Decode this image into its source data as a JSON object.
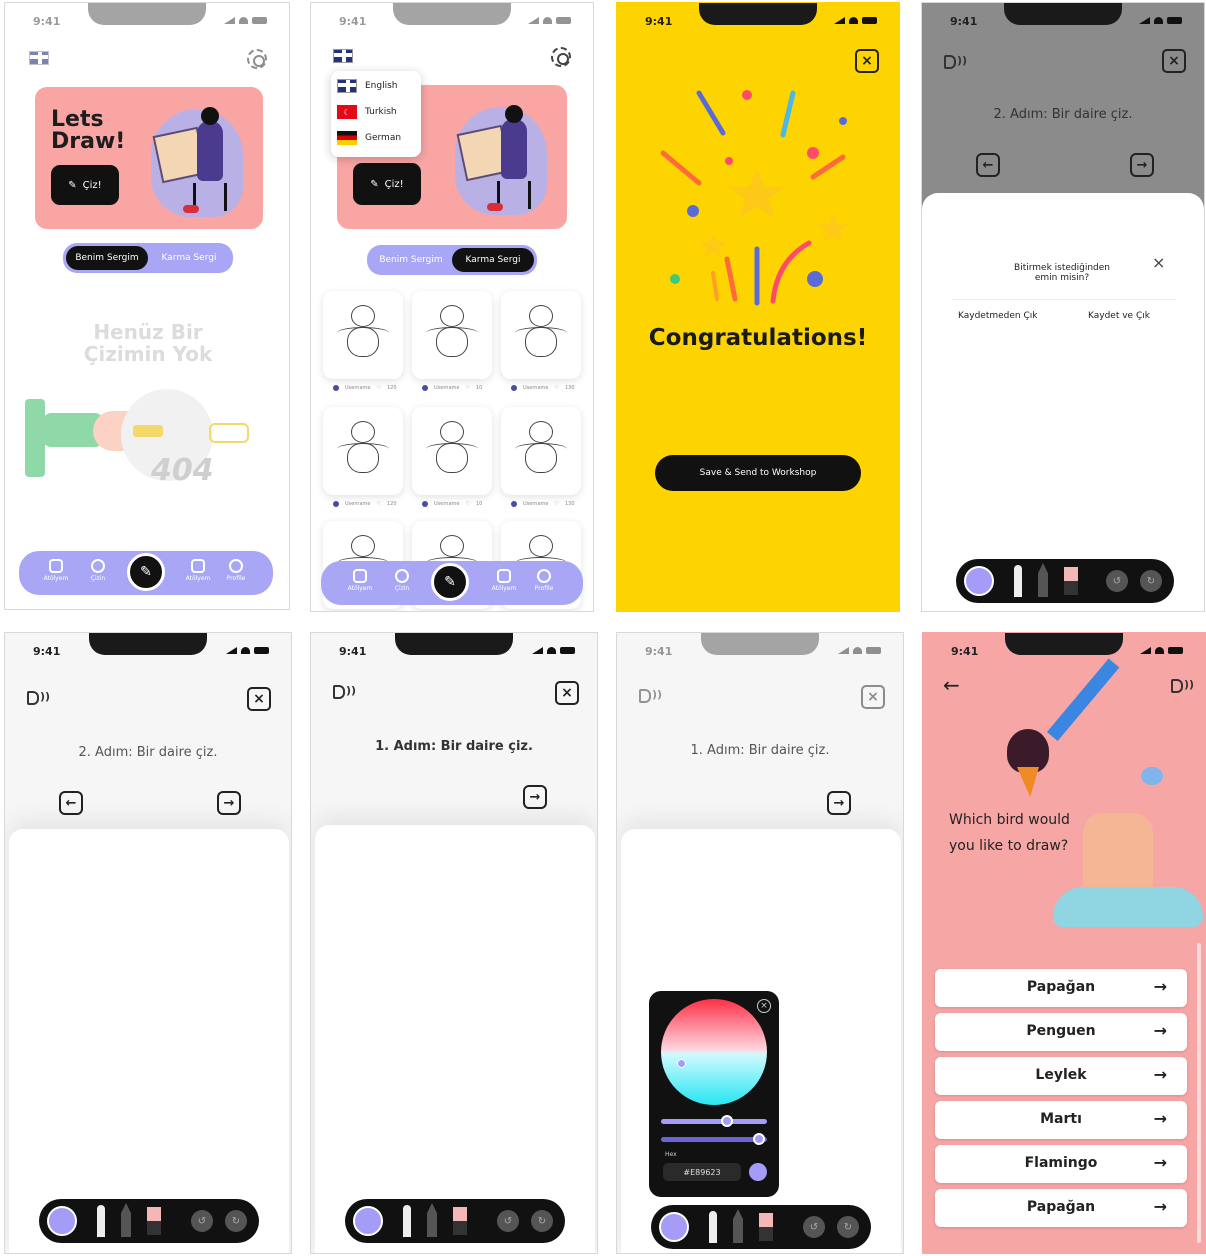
{
  "colors": {
    "hero": "#f8a5a4",
    "accent": "#a9a6f6",
    "yellow": "#fdd400",
    "salmon": "#f7a6a6",
    "gray": "#8b8b8b"
  },
  "status": {
    "time": "9:41"
  },
  "home": {
    "title": "Lets Draw!",
    "draw_button": "Çiz!",
    "tabs": [
      "Benim Sergim",
      "Karma Sergi"
    ],
    "empty_text": "Henüz Bir Çizimin Yok",
    "error_code": "404",
    "nav": [
      "Atölyem",
      "Çizin",
      "Atölyem",
      "Profile"
    ]
  },
  "gallery": {
    "languages": [
      "English",
      "Turkish",
      "German"
    ],
    "draw_button": "Çiz!",
    "tabs": [
      "Benim Sergim",
      "Karma Sergi"
    ],
    "cards": [
      {
        "user": "Username",
        "likes": "120"
      },
      {
        "user": "Username",
        "likes": "10"
      },
      {
        "user": "Username",
        "likes": "130"
      },
      {
        "user": "Username",
        "likes": "120"
      },
      {
        "user": "Username",
        "likes": "10"
      },
      {
        "user": "Username",
        "likes": "130"
      }
    ],
    "nav": [
      "Atölyem",
      "Çizin",
      "Atölyem",
      "Profile"
    ]
  },
  "congrats": {
    "title": "Congratulations!",
    "button": "Save & Send to Workshop"
  },
  "dialog": {
    "step": "2. Adım: Bir daire çiz.",
    "question": "Bitirmek istediğinden emin misin?",
    "option_1": "Kaydetmeden Çık",
    "option_2": "Kaydet ve Çık"
  },
  "canvas_a": {
    "step": "2. Adım: Bir daire çiz."
  },
  "canvas_b": {
    "step": "1. Adım: Bir daire çiz."
  },
  "canvas_c": {
    "step": "1. Adım: Bir daire çiz.",
    "picker_label": "Hex",
    "hex": "#E89623"
  },
  "birds": {
    "question": "Which bird would you like to draw?",
    "options": [
      "Papağan",
      "Penguen",
      "Leylek",
      "Martı",
      "Flamingo",
      "Papağan"
    ]
  }
}
